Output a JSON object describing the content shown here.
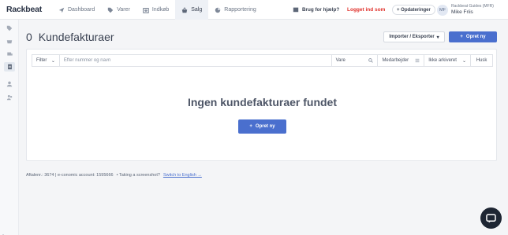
{
  "app": {
    "logo": "Rackbeat"
  },
  "nav": [
    {
      "label": "Dashboard",
      "icon": "paper-plane-icon",
      "active": false
    },
    {
      "label": "Varer",
      "icon": "tag-icon",
      "active": false
    },
    {
      "label": "Indkøb",
      "icon": "cart-in-icon",
      "active": false
    },
    {
      "label": "Salg",
      "icon": "basket-icon",
      "active": true
    },
    {
      "label": "Rapportering",
      "icon": "pie-chart-icon",
      "active": false
    }
  ],
  "header": {
    "help": "Brug for hjælp?",
    "logged_in": "Logget ind som",
    "updates": "+ Opdateringer",
    "avatar": "MF",
    "account": "Rackbeat Guides (MFR)",
    "user": "Mike Friis"
  },
  "page": {
    "count": "0",
    "title": "Kundefakturaer",
    "import_export": "Importer / Eksporter",
    "create": "Opret ny"
  },
  "filters": {
    "filter": "Filter",
    "search_placeholder": "Efter nummer og navn",
    "item": "Vare",
    "employee": "Medarbejder",
    "archived": "Ikke arkiveret",
    "remember": "Husk"
  },
  "empty": {
    "title": "Ingen kundefakturaer fundet",
    "create": "Opret ny"
  },
  "footer": {
    "agreement": "Aftalenr.: 3674 | e-conomic account: 1595666",
    "screenshot": "• Taking a screenshot?",
    "switch": "Switch to English →"
  }
}
